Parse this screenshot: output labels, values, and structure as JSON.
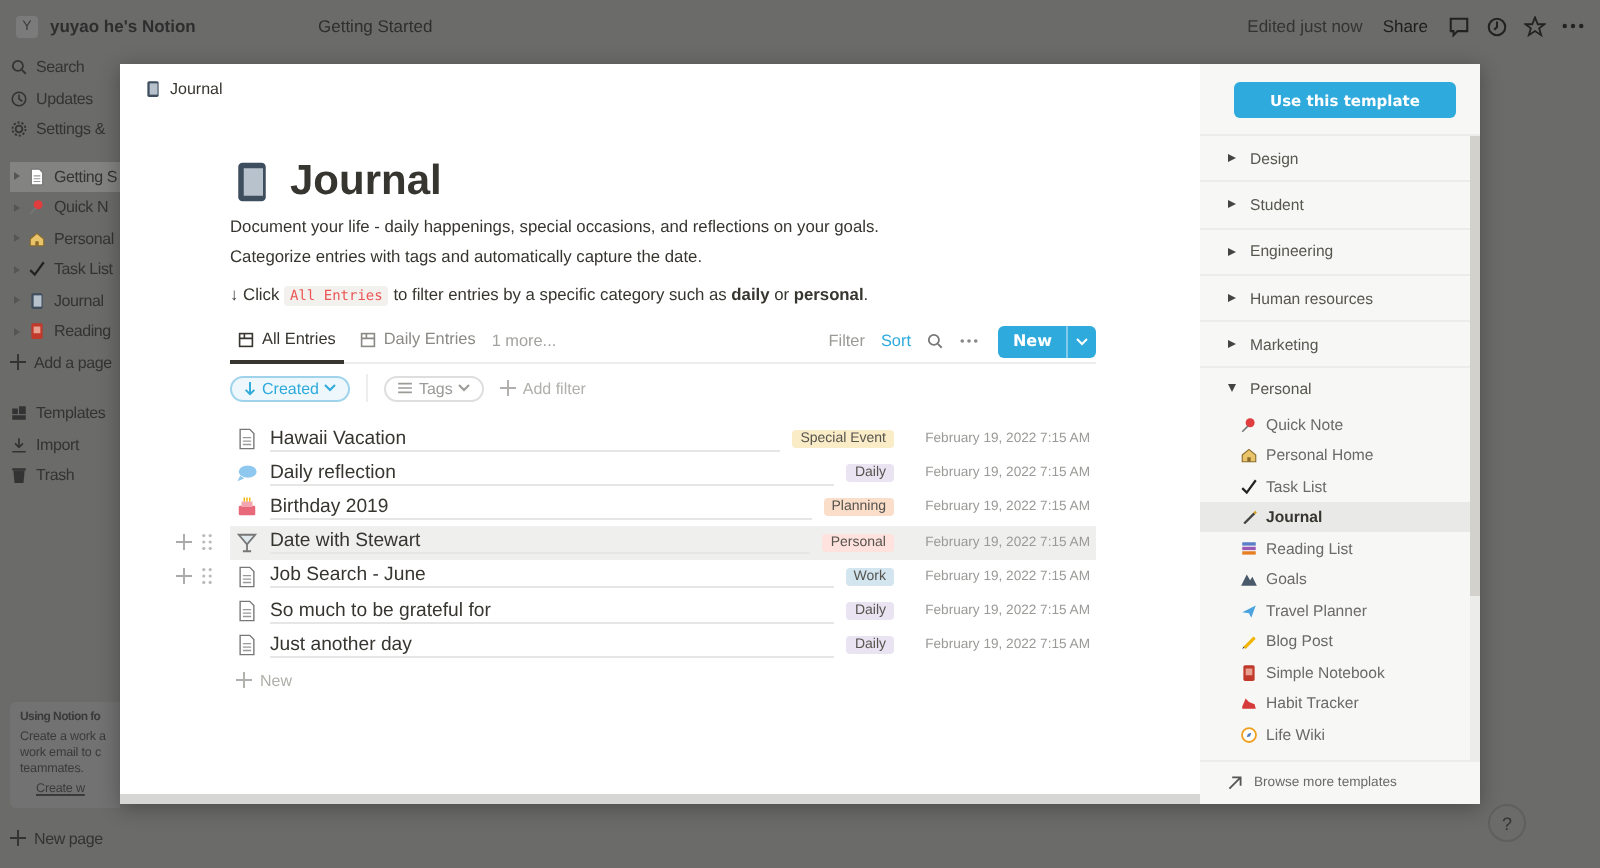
{
  "topbar": {
    "workspace_initial": "Y",
    "workspace": "yuyao he's Notion",
    "breadcrumb": "Getting Started",
    "edited": "Edited just now",
    "share": "Share"
  },
  "sidebar": {
    "nav": [
      {
        "kind": "search",
        "label": "Search"
      },
      {
        "kind": "clock",
        "label": "Updates"
      },
      {
        "kind": "gear",
        "label": "Settings &"
      }
    ],
    "pages": [
      {
        "kind": "page",
        "label": "Getting S",
        "selected": true
      },
      {
        "kind": "pin",
        "label": "Quick N",
        "selected": false
      },
      {
        "kind": "house",
        "label": "Personal",
        "selected": false
      },
      {
        "kind": "check",
        "label": "Task List",
        "selected": false
      },
      {
        "kind": "notebook",
        "label": "Journal",
        "selected": false
      },
      {
        "kind": "book",
        "label": "Reading",
        "selected": false
      }
    ],
    "add_page": "Add a page",
    "tools": [
      {
        "kind": "templates",
        "label": "Templates"
      },
      {
        "kind": "import",
        "label": "Import"
      },
      {
        "kind": "trash",
        "label": "Trash"
      }
    ],
    "promo": {
      "title": "Using Notion fo",
      "lines": [
        "Create a work a",
        "work email to c",
        "teammates."
      ],
      "link": "Create w"
    },
    "new_page": "New page"
  },
  "help": "?",
  "modal": {
    "breadcrumb": "Journal",
    "title": "Journal",
    "description": [
      "Document your life - daily happenings, special occasions, and reflections on your goals.",
      "Categorize entries with tags and automatically capture the date."
    ],
    "tip": {
      "before": "↓ Click",
      "code": "All Entries",
      "after": "to filter entries by a specific category such as **daily** or **personal**."
    },
    "views": [
      {
        "label": "All Entries",
        "selected": true
      },
      {
        "label": "Daily Entries",
        "selected": false
      }
    ],
    "more_views": "1 more...",
    "actions": {
      "filter": "Filter",
      "sort": "Sort",
      "new": "New"
    },
    "filters": {
      "sort": "Created",
      "tags": "Tags",
      "add": "Add filter"
    },
    "rows": [
      {
        "kind": "page",
        "title": "Hawaii Vacation",
        "tag": "Special Event",
        "color": "#fbecc8",
        "date": "February 19, 2022 7:15 AM",
        "hovered": false,
        "handles": false
      },
      {
        "kind": "bubble",
        "title": "Daily reflection",
        "tag": "Daily",
        "color": "#eae4f2",
        "date": "February 19, 2022 7:15 AM",
        "hovered": false,
        "handles": false
      },
      {
        "kind": "cake",
        "title": "Birthday 2019",
        "tag": "Planning",
        "color": "#fadec9",
        "date": "February 19, 2022 7:15 AM",
        "hovered": false,
        "handles": false
      },
      {
        "kind": "cocktail",
        "title": "Date with Stewart",
        "tag": "Personal",
        "color": "#ffe2dd",
        "date": "February 19, 2022 7:15 AM",
        "hovered": true,
        "handles": true
      },
      {
        "kind": "page",
        "title": "Job Search - June",
        "tag": "Work",
        "color": "#d3e5ef",
        "date": "February 19, 2022 7:15 AM",
        "hovered": false,
        "handles": true
      },
      {
        "kind": "page",
        "title": "So much to be grateful for",
        "tag": "Daily",
        "color": "#eae4f2",
        "date": "February 19, 2022 7:15 AM",
        "hovered": false,
        "handles": false
      },
      {
        "kind": "page",
        "title": "Just another day",
        "tag": "Daily",
        "color": "#eae4f2",
        "date": "February 19, 2022 7:15 AM",
        "hovered": false,
        "handles": false
      }
    ],
    "add_row": "New"
  },
  "templates": {
    "button": "Use this template",
    "categories": [
      {
        "label": "Design",
        "expanded": false
      },
      {
        "label": "Student",
        "expanded": false
      },
      {
        "label": "Engineering",
        "expanded": false
      },
      {
        "label": "Human resources",
        "expanded": false
      },
      {
        "label": "Marketing",
        "expanded": false
      },
      {
        "label": "Personal",
        "expanded": true,
        "children": [
          {
            "kind": "pin",
            "label": "Quick Note",
            "selected": false
          },
          {
            "kind": "house",
            "label": "Personal Home",
            "selected": false
          },
          {
            "kind": "check",
            "label": "Task List",
            "selected": false
          },
          {
            "kind": "pen",
            "label": "Journal",
            "selected": true
          },
          {
            "kind": "books",
            "label": "Reading List",
            "selected": false
          },
          {
            "kind": "mountain",
            "label": "Goals",
            "selected": false
          },
          {
            "kind": "plane",
            "label": "Travel Planner",
            "selected": false
          },
          {
            "kind": "pencil",
            "label": "Blog Post",
            "selected": false
          },
          {
            "kind": "book",
            "label": "Simple Notebook",
            "selected": false
          },
          {
            "kind": "shoe",
            "label": "Habit Tracker",
            "selected": false
          },
          {
            "kind": "compass",
            "label": "Life Wiki",
            "selected": false
          }
        ]
      }
    ],
    "browse": "Browse more templates"
  }
}
